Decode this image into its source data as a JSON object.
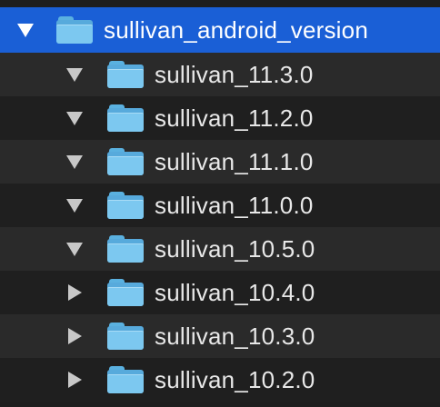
{
  "root": {
    "label": "sullivan_android_version",
    "expanded": true,
    "icon": "folder-icon",
    "selected_color": "#1a5fd6"
  },
  "children": [
    {
      "label": "sullivan_11.3.0",
      "expanded": true
    },
    {
      "label": "sullivan_11.2.0",
      "expanded": true
    },
    {
      "label": "sullivan_11.1.0",
      "expanded": true
    },
    {
      "label": "sullivan_11.0.0",
      "expanded": true
    },
    {
      "label": "sullivan_10.5.0",
      "expanded": true
    },
    {
      "label": "sullivan_10.4.0",
      "expanded": false
    },
    {
      "label": "sullivan_10.3.0",
      "expanded": false
    },
    {
      "label": "sullivan_10.2.0",
      "expanded": false
    }
  ]
}
